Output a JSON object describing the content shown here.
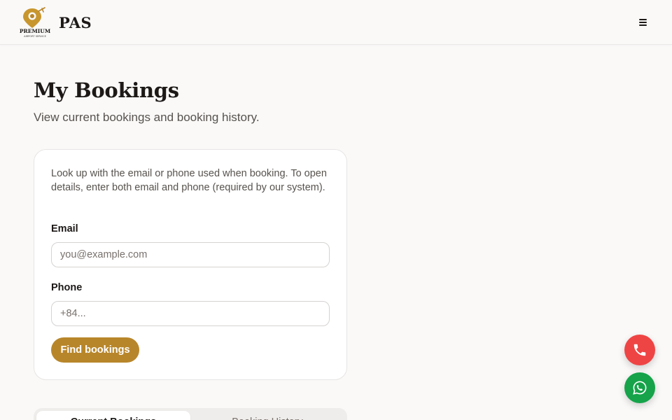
{
  "header": {
    "logo_text": "PREMIUM",
    "logo_subtext": "AIRPORT SERVICE",
    "brand": "PAS",
    "menu_icon": "hamburger-menu-icon"
  },
  "page": {
    "title": "My Bookings",
    "subtitle": "View current bookings and booking history."
  },
  "lookup": {
    "description": "Look up with the email or phone used when booking. To open details, enter both email and phone (required by our system).",
    "email_label": "Email",
    "email_value": "",
    "email_placeholder": "you@example.com",
    "phone_label": "Phone",
    "phone_value": "",
    "phone_placeholder": "+84...",
    "submit_label": "Find bookings"
  },
  "tabs": [
    {
      "label": "Current Bookings",
      "active": true
    },
    {
      "label": "Booking History",
      "active": false
    }
  ],
  "floating_actions": {
    "call_icon": "phone-icon",
    "whatsapp_icon": "whatsapp-icon"
  },
  "colors": {
    "accent": "#b8862a",
    "call": "#ef4444",
    "whatsapp": "#16a34a",
    "background": "#faf9f8"
  }
}
